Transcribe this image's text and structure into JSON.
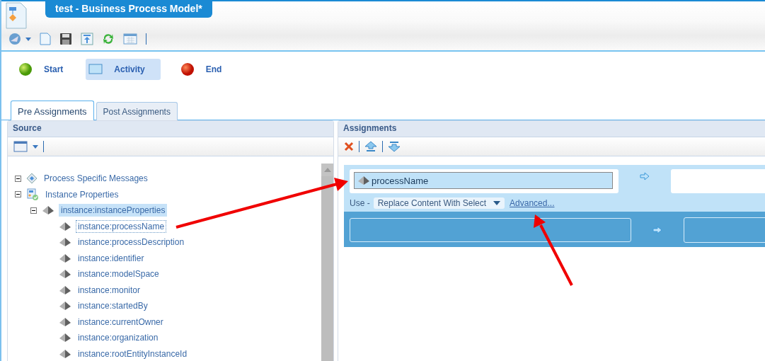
{
  "window": {
    "title": "test - Business Process Model*"
  },
  "palette": [
    {
      "label": "Start",
      "kind": "start",
      "selected": false
    },
    {
      "label": "Activity",
      "kind": "activity",
      "selected": true
    },
    {
      "label": "End",
      "kind": "end",
      "selected": false
    }
  ],
  "tabs": [
    {
      "label": "Pre Assignments",
      "selected": true
    },
    {
      "label": "Post Assignments",
      "selected": false
    }
  ],
  "source": {
    "title": "Source",
    "tree": [
      {
        "label": "Process Specific Messages",
        "kind": "messages",
        "expanded": true,
        "selected": false
      },
      {
        "label": "Instance Properties",
        "kind": "properties",
        "expanded": true,
        "selected": false,
        "children": [
          {
            "label": "instance:instanceProperties",
            "kind": "element",
            "expanded": true,
            "selected": true,
            "children": [
              {
                "label": "instance:processName",
                "kind": "element",
                "selected": false,
                "focused": true
              },
              {
                "label": "instance:processDescription",
                "kind": "element",
                "selected": false
              },
              {
                "label": "instance:identifier",
                "kind": "element",
                "selected": false
              },
              {
                "label": "instance:modelSpace",
                "kind": "element",
                "selected": false
              },
              {
                "label": "instance:monitor",
                "kind": "element",
                "selected": false
              },
              {
                "label": "instance:startedBy",
                "kind": "element",
                "selected": false
              },
              {
                "label": "instance:currentOwner",
                "kind": "element",
                "selected": false
              },
              {
                "label": "instance:organization",
                "kind": "element",
                "selected": false
              },
              {
                "label": "instance:rootEntityInstanceId",
                "kind": "element",
                "selected": false
              }
            ]
          }
        ]
      }
    ]
  },
  "assignments": {
    "title": "Assignments",
    "rows": [
      {
        "source": "processName",
        "use_label": "Use -",
        "mode": "Replace Content With Select",
        "advanced": "Advanced...",
        "selected": true
      },
      {
        "selected": false
      }
    ]
  }
}
